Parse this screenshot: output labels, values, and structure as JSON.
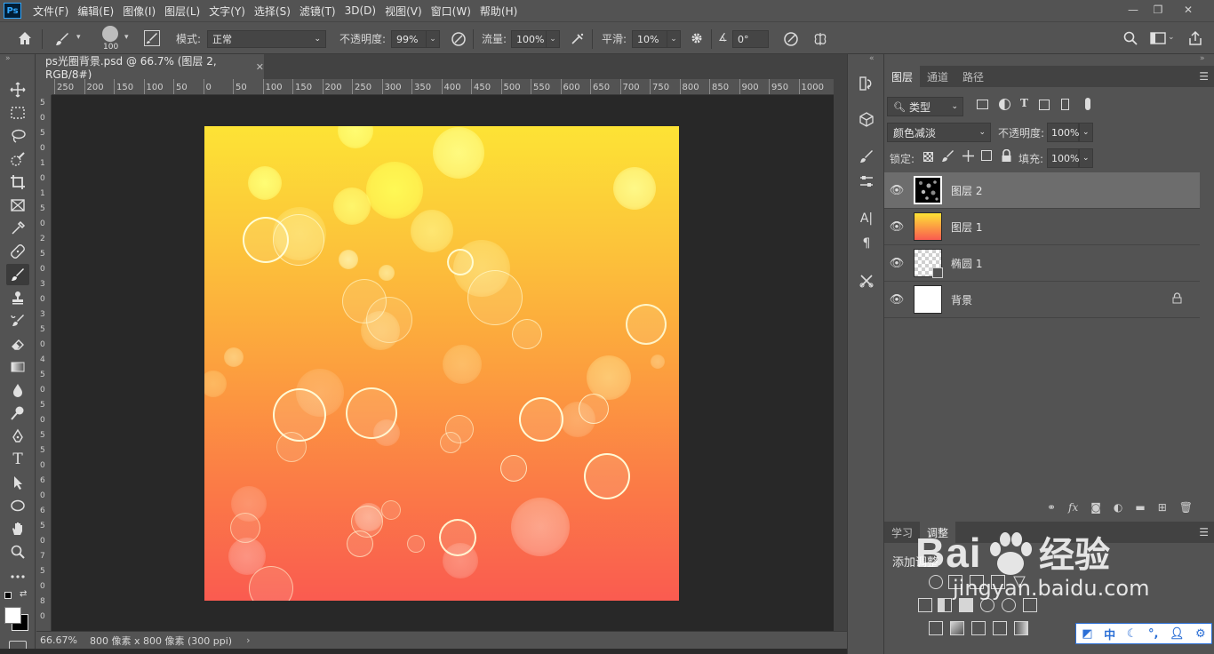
{
  "menubar": {
    "logo": "Ps",
    "items": [
      "文件(F)",
      "编辑(E)",
      "图像(I)",
      "图层(L)",
      "文字(Y)",
      "选择(S)",
      "滤镜(T)",
      "3D(D)",
      "视图(V)",
      "窗口(W)",
      "帮助(H)"
    ]
  },
  "options": {
    "brush_size": "100",
    "mode_label": "模式:",
    "mode_value": "正常",
    "opacity_label": "不透明度:",
    "opacity_value": "99%",
    "flow_label": "流量:",
    "flow_value": "100%",
    "smooth_label": "平滑:",
    "smooth_value": "10%",
    "angle_value": "0°"
  },
  "document": {
    "tab_title": "ps光圈背景.psd @ 66.7% (图层 2, RGB/8#)",
    "zoom": "66.67%",
    "info": "800 像素 x 800 像素 (300 ppi)",
    "ruler_ticks": [
      "250",
      "200",
      "150",
      "100",
      "50",
      "0",
      "50",
      "100",
      "150",
      "200",
      "250",
      "300",
      "350",
      "400",
      "450",
      "500",
      "550",
      "600",
      "650",
      "700",
      "750",
      "800",
      "850",
      "900",
      "950",
      "1000"
    ],
    "ruler_left_ticks": [
      "5",
      "0",
      "5",
      "0",
      "1",
      "0",
      "1",
      "5",
      "0",
      "2",
      "5",
      "0",
      "3",
      "0",
      "3",
      "5",
      "0",
      "4",
      "5",
      "0",
      "5",
      "0",
      "5",
      "5",
      "0",
      "6",
      "0",
      "6",
      "5",
      "0",
      "7",
      "5",
      "0",
      "8",
      "0"
    ]
  },
  "layers_panel": {
    "tabs": [
      "图层",
      "通道",
      "路径"
    ],
    "filter_kind": "类型",
    "blend_mode": "颜色减淡",
    "opacity_label": "不透明度:",
    "opacity_value": "100%",
    "lock_label": "锁定:",
    "fill_label": "填充:",
    "fill_value": "100%",
    "layers": [
      {
        "name": "图层 2",
        "selected": true
      },
      {
        "name": "图层 1",
        "selected": false
      },
      {
        "name": "椭圆 1",
        "selected": false
      },
      {
        "name": "背景",
        "selected": false,
        "locked": true
      }
    ]
  },
  "adjust_panel": {
    "tabs": [
      "学习",
      "调整"
    ],
    "title": "添加调整"
  },
  "watermark": {
    "brand": "Bai",
    "brand2": "经验",
    "url": "jingyan.baidu.com"
  },
  "ime": {
    "items": [
      "中"
    ]
  }
}
